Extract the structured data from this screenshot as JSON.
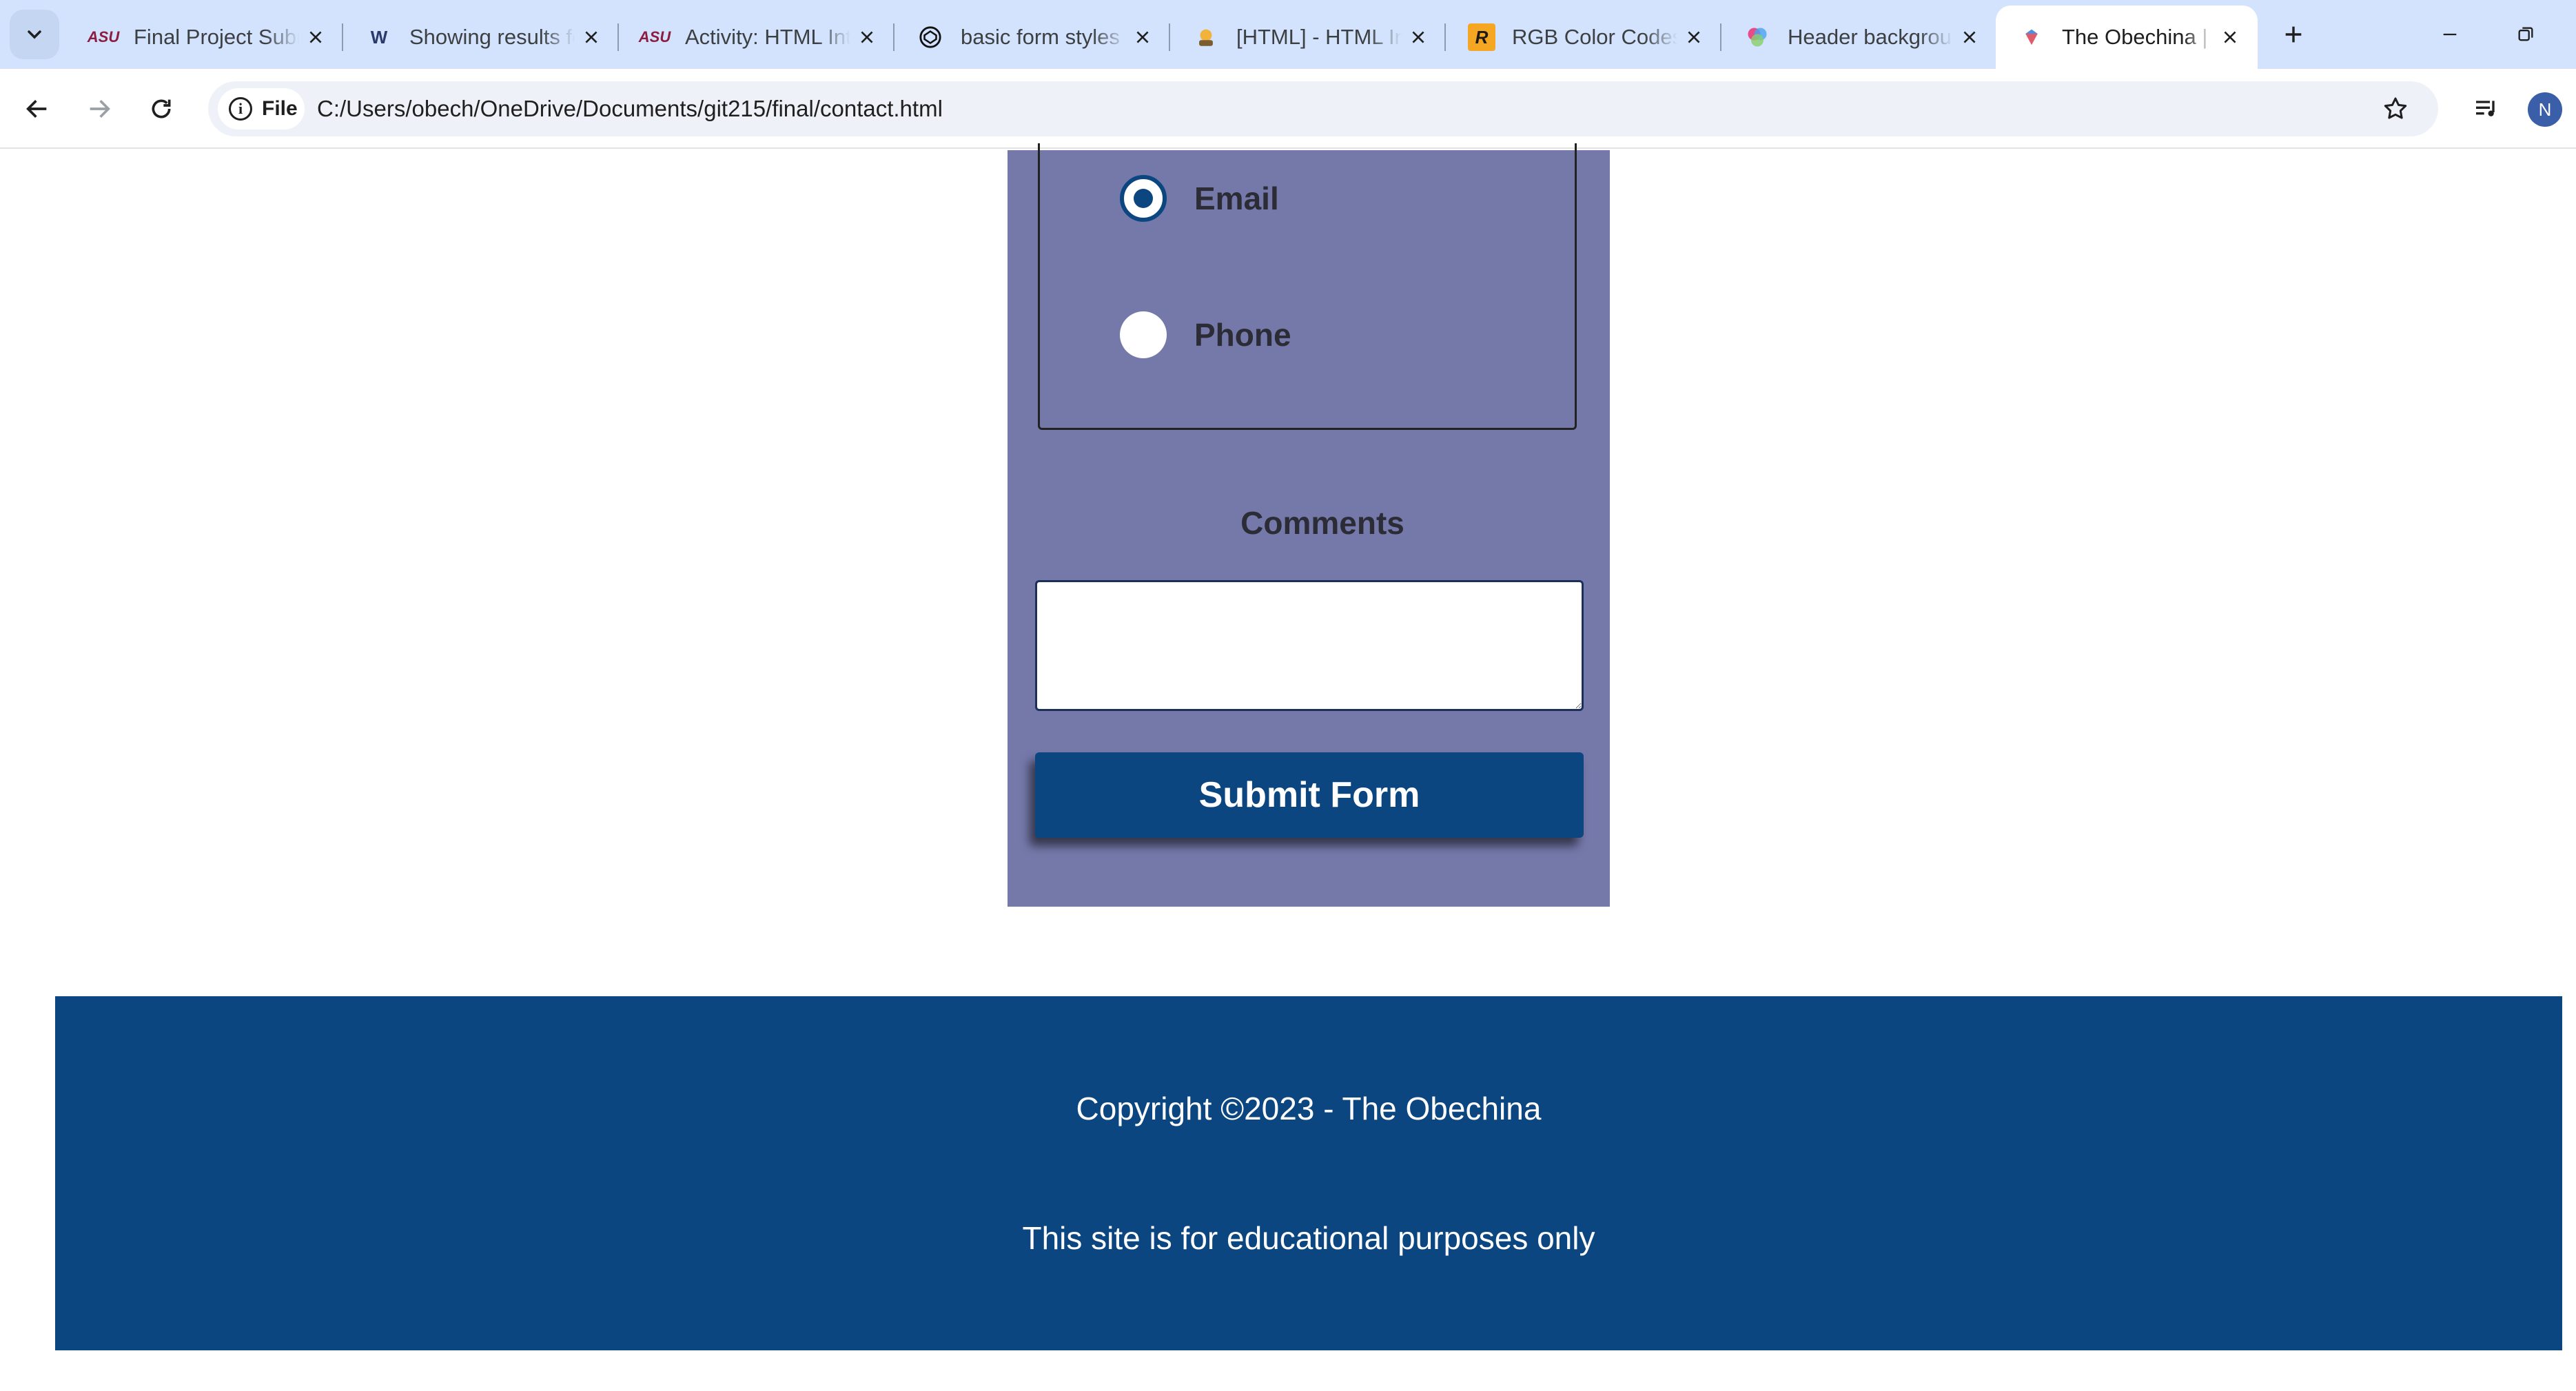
{
  "browser": {
    "tabs": [
      {
        "title": "Final Project Submission",
        "favicon": "asu-logo-icon",
        "active": false
      },
      {
        "title": "Showing results for",
        "favicon": "w3-validator-icon",
        "active": false
      },
      {
        "title": "Activity: HTML Introduction",
        "favicon": "asu-logo-icon",
        "active": false
      },
      {
        "title": "basic form styles",
        "favicon": "codepen-icon",
        "active": false
      },
      {
        "title": "[HTML] - HTML Input",
        "favicon": "sololearn-icon",
        "active": false
      },
      {
        "title": "RGB Color Codes",
        "favicon": "rapidtables-icon",
        "active": false
      },
      {
        "title": "Header background",
        "favicon": "colorful-circle-icon",
        "active": false
      },
      {
        "title": "The Obechina | Contact",
        "favicon": "page-icon",
        "active": true
      }
    ],
    "favicon_text": {
      "asu": "ASU",
      "w3": "W",
      "rapidtables": "R"
    },
    "address_chip": "File",
    "info_glyph": "i",
    "url": "C:/Users/obech/OneDrive/Documents/git215/final/contact.html",
    "profile_initial": "N"
  },
  "page": {
    "contact_options": [
      {
        "label": "Email",
        "checked": true
      },
      {
        "label": "Phone",
        "checked": false
      }
    ],
    "comments_label": "Comments",
    "comments_value": "",
    "submit_label": "Submit Form",
    "footer": {
      "copyright": "Copyright ©2023 - The Obechina",
      "disclaimer": "This site is for educational purposes only"
    }
  },
  "colors": {
    "form_panel": "#7579aa",
    "brand_blue": "#0b4680",
    "tabbar": "#d3e3fd"
  }
}
